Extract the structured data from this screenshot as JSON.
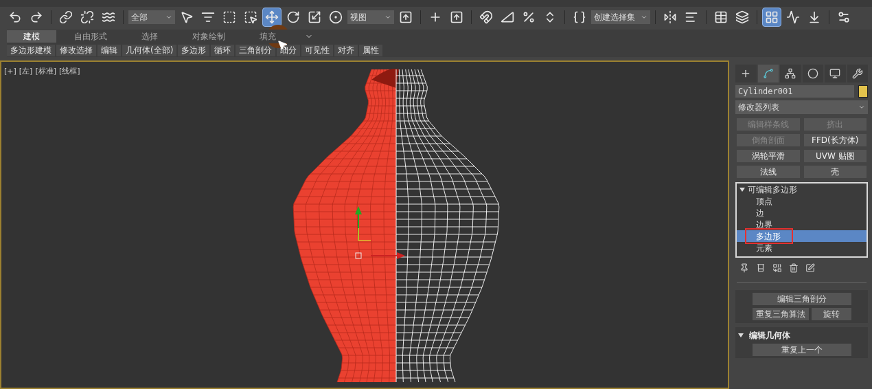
{
  "toolbar": [
    {
      "kind": "icon",
      "selected": false
    },
    {
      "kind": "icon",
      "selected": false
    },
    {
      "kind": "separator"
    },
    {
      "kind": "icon",
      "selected": false
    },
    {
      "kind": "icon",
      "selected": false
    },
    {
      "kind": "icon",
      "selected": false
    },
    {
      "kind": "separator"
    },
    {
      "kind": "dropdown",
      "value": "全部"
    },
    {
      "kind": "icon",
      "selected": false
    },
    {
      "kind": "icon",
      "selected": false
    },
    {
      "kind": "icon",
      "selected": false
    },
    {
      "kind": "icon",
      "selected": false
    },
    {
      "kind": "icon",
      "selected": true
    },
    {
      "kind": "icon",
      "selected": false
    },
    {
      "kind": "icon",
      "selected": false
    },
    {
      "kind": "icon",
      "selected": false
    },
    {
      "kind": "dropdown",
      "value": "视图"
    },
    {
      "kind": "icon",
      "selected": false
    },
    {
      "kind": "separator"
    },
    {
      "kind": "icon",
      "selected": false
    },
    {
      "kind": "icon",
      "selected": false
    },
    {
      "kind": "separator"
    },
    {
      "kind": "icon",
      "selected": false
    },
    {
      "kind": "icon",
      "selected": false
    },
    {
      "kind": "icon",
      "selected": false
    },
    {
      "kind": "icon",
      "selected": false
    },
    {
      "kind": "separator"
    },
    {
      "kind": "icon",
      "selected": false
    },
    {
      "kind": "dropdown",
      "value": "创建选择集"
    },
    {
      "kind": "separator"
    },
    {
      "kind": "icon",
      "selected": false
    },
    {
      "kind": "icon",
      "selected": false
    },
    {
      "kind": "separator"
    },
    {
      "kind": "icon",
      "selected": false
    },
    {
      "kind": "icon",
      "selected": false
    },
    {
      "kind": "separator"
    },
    {
      "kind": "icon",
      "selected": true
    },
    {
      "kind": "icon",
      "selected": false
    },
    {
      "kind": "icon",
      "selected": false
    },
    {
      "kind": "separator"
    },
    {
      "kind": "icon",
      "selected": false
    }
  ],
  "ribbon_tabs": [
    {
      "label": "建模",
      "selected": true
    },
    {
      "label": "自由形式",
      "selected": false
    },
    {
      "label": "选择",
      "selected": false
    },
    {
      "label": "对象绘制",
      "selected": false
    },
    {
      "label": "填充",
      "selected": false
    }
  ],
  "ribbon_panels": [
    "多边形建模",
    "修改选择",
    "编辑",
    "几何体(全部)",
    "多边形",
    "循环",
    "三角剖分",
    "细分",
    "可见性",
    "对齐",
    "属性"
  ],
  "viewport": {
    "labels": [
      "[+]",
      "[左]",
      "[标准]",
      "[线框]"
    ]
  },
  "command_panel": {
    "tabs": [
      {
        "selected": false
      },
      {
        "selected": true
      },
      {
        "selected": false
      },
      {
        "selected": false
      },
      {
        "selected": false
      },
      {
        "selected": false
      }
    ],
    "object_name": "Cylinder001",
    "modifier_list": "修改器列表",
    "modifier_buttons": [
      {
        "label": "编辑样条线",
        "disabled": true
      },
      {
        "label": "挤出",
        "disabled": true
      },
      {
        "label": "倒角剖面",
        "disabled": true
      },
      {
        "label": "FFD(长方体)",
        "disabled": false
      },
      {
        "label": "涡轮平滑",
        "disabled": false
      },
      {
        "label": "UVW 贴图",
        "disabled": false
      },
      {
        "label": "法线",
        "disabled": false
      },
      {
        "label": "壳",
        "disabled": false
      }
    ],
    "stack": {
      "label": "可编辑多边形",
      "expanded": true,
      "children": [
        {
          "label": "顶点",
          "selected": false
        },
        {
          "label": "边",
          "selected": false
        },
        {
          "label": "边界",
          "selected": false
        },
        {
          "label": "多边形",
          "selected": true
        },
        {
          "label": "元素",
          "selected": false
        }
      ]
    },
    "rollout_buttons": [
      {
        "label": "编辑三角剖分"
      },
      {
        "label": "重复三角算法"
      },
      {
        "label": "旋转"
      }
    ],
    "rollout": {
      "title": "编辑几何体",
      "expanded": true,
      "buttons": [
        "重复上一个"
      ]
    }
  }
}
